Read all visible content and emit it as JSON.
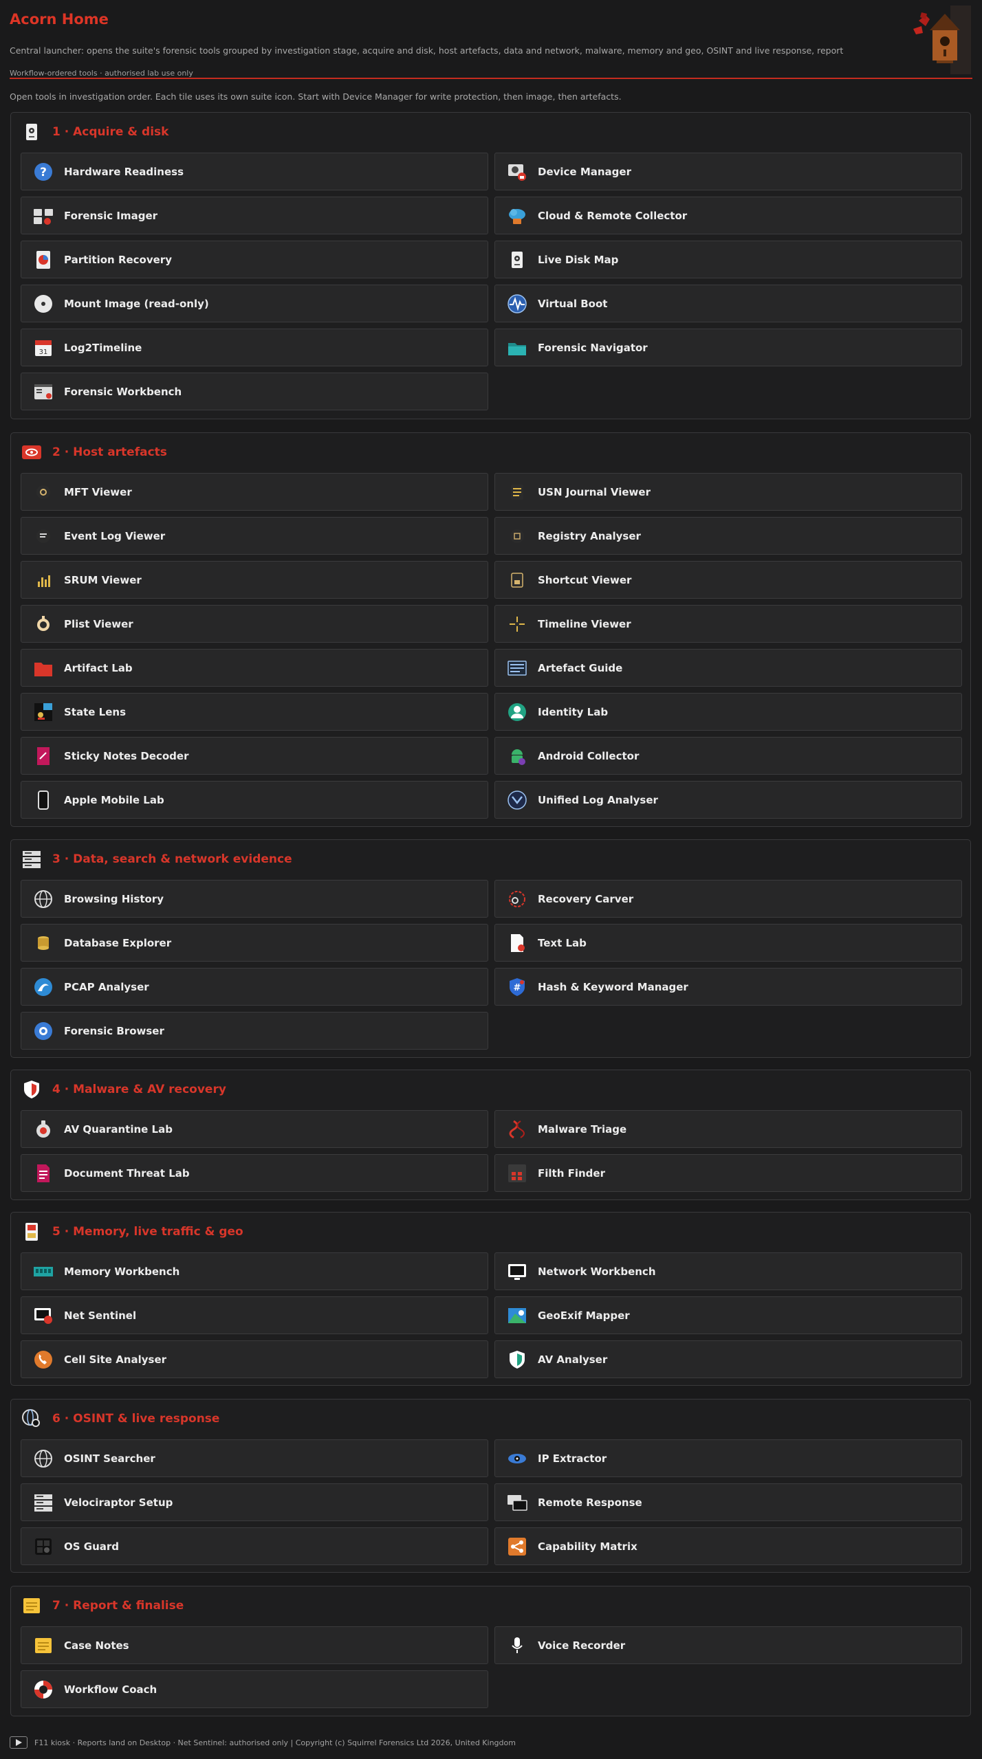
{
  "header": {
    "title": "Acorn Home",
    "subtitle": "Central launcher: opens the suite's forensic tools grouped by investigation stage, acquire and disk, host artefacts, data and network, malware, memory and geo, OSINT and live response, report",
    "note": "Workflow-ordered tools · authorised lab use only",
    "logo_icon": "birdhouse-squirrel-icon"
  },
  "intro": "Open tools in investigation order. Each tile uses its own suite icon. Start with Device Manager for write protection, then image, then artefacts.",
  "accent_color": "#d8362a",
  "sections": [
    {
      "title": "1 · Acquire & disk",
      "icon": "disk-drive-icon",
      "tools": [
        {
          "label": "Hardware Readiness",
          "icon": "question-circle-icon"
        },
        {
          "label": "Device Manager",
          "icon": "device-lock-icon"
        },
        {
          "label": "Forensic Imager",
          "icon": "imager-icon"
        },
        {
          "label": "Cloud & Remote Collector",
          "icon": "cloud-icon"
        },
        {
          "label": "Partition Recovery",
          "icon": "partition-icon"
        },
        {
          "label": "Live Disk Map",
          "icon": "disk-drive-icon"
        },
        {
          "label": "Mount Image (read-only)",
          "icon": "optical-disc-icon"
        },
        {
          "label": "Virtual Boot",
          "icon": "pulse-icon"
        },
        {
          "label": "Log2Timeline",
          "icon": "calendar-icon"
        },
        {
          "label": "Forensic Navigator",
          "icon": "folder-open-icon"
        },
        {
          "label": "Forensic Workbench",
          "icon": "workbench-window-icon"
        }
      ]
    },
    {
      "title": "2 · Host artefacts",
      "icon": "eye-badge-icon",
      "tools": [
        {
          "label": "MFT Viewer",
          "icon": "mft-icon"
        },
        {
          "label": "USN Journal Viewer",
          "icon": "journal-icon"
        },
        {
          "label": "Event Log Viewer",
          "icon": "event-log-icon"
        },
        {
          "label": "Registry Analyser",
          "icon": "registry-icon"
        },
        {
          "label": "SRUM Viewer",
          "icon": "bar-chart-icon"
        },
        {
          "label": "Shortcut Viewer",
          "icon": "shortcut-icon"
        },
        {
          "label": "Plist Viewer",
          "icon": "plist-icon"
        },
        {
          "label": "Timeline Viewer",
          "icon": "crosshair-icon"
        },
        {
          "label": "Artifact Lab",
          "icon": "red-folder-icon"
        },
        {
          "label": "Artefact Guide",
          "icon": "guide-screen-icon"
        },
        {
          "label": "State Lens",
          "icon": "state-lens-icon"
        },
        {
          "label": "Identity Lab",
          "icon": "user-circle-icon"
        },
        {
          "label": "Sticky Notes Decoder",
          "icon": "sticky-note-icon"
        },
        {
          "label": "Android Collector",
          "icon": "android-icon"
        },
        {
          "label": "Apple Mobile Lab",
          "icon": "phone-icon"
        },
        {
          "label": "Unified Log Analyser",
          "icon": "unified-log-icon"
        }
      ]
    },
    {
      "title": "3 · Data, search & network evidence",
      "icon": "server-rack-icon",
      "tools": [
        {
          "label": "Browsing History",
          "icon": "globe-icon"
        },
        {
          "label": "Recovery Carver",
          "icon": "magnifier-ring-icon"
        },
        {
          "label": "Database Explorer",
          "icon": "database-icon"
        },
        {
          "label": "Text Lab",
          "icon": "text-doc-icon"
        },
        {
          "label": "PCAP Analyser",
          "icon": "shark-fin-icon"
        },
        {
          "label": "Hash & Keyword Manager",
          "icon": "hash-shield-icon"
        },
        {
          "label": "Forensic Browser",
          "icon": "browser-icon"
        }
      ]
    },
    {
      "title": "4 · Malware & AV recovery",
      "icon": "shield-icon",
      "tools": [
        {
          "label": "AV Quarantine Lab",
          "icon": "quarantine-icon"
        },
        {
          "label": "Malware Triage",
          "icon": "dna-icon"
        },
        {
          "label": "Document Threat Lab",
          "icon": "doc-threat-icon"
        },
        {
          "label": "Filth Finder",
          "icon": "grid-icon"
        }
      ]
    },
    {
      "title": "5 · Memory, live traffic & geo",
      "icon": "sd-card-icon",
      "tools": [
        {
          "label": "Memory Workbench",
          "icon": "ram-icon"
        },
        {
          "label": "Network Workbench",
          "icon": "monitor-icon"
        },
        {
          "label": "Net Sentinel",
          "icon": "net-sentinel-icon"
        },
        {
          "label": "GeoExif Mapper",
          "icon": "map-icon"
        },
        {
          "label": "Cell Site Analyser",
          "icon": "phone-call-icon"
        },
        {
          "label": "AV Analyser",
          "icon": "shield-green-icon"
        }
      ]
    },
    {
      "title": "6 · OSINT & live response",
      "icon": "globe-search-icon",
      "tools": [
        {
          "label": "OSINT Searcher",
          "icon": "globe-icon"
        },
        {
          "label": "IP Extractor",
          "icon": "eye-icon"
        },
        {
          "label": "Velociraptor Setup",
          "icon": "server-rack-icon"
        },
        {
          "label": "Remote Response",
          "icon": "remote-screen-icon"
        },
        {
          "label": "OS Guard",
          "icon": "os-guard-icon"
        },
        {
          "label": "Capability Matrix",
          "icon": "share-icon"
        }
      ]
    },
    {
      "title": "7 · Report & finalise",
      "icon": "note-pad-icon",
      "tools": [
        {
          "label": "Case Notes",
          "icon": "note-pad-icon"
        },
        {
          "label": "Voice Recorder",
          "icon": "microphone-icon"
        },
        {
          "label": "Workflow Coach",
          "icon": "lifebuoy-icon"
        }
      ]
    }
  ],
  "footer": {
    "icon": "play-icon",
    "text": "F11 kiosk · Reports land on Desktop · Net Sentinel: authorised only  |  Copyright (c) Squirrel Forensics Ltd 2026, United Kingdom"
  }
}
